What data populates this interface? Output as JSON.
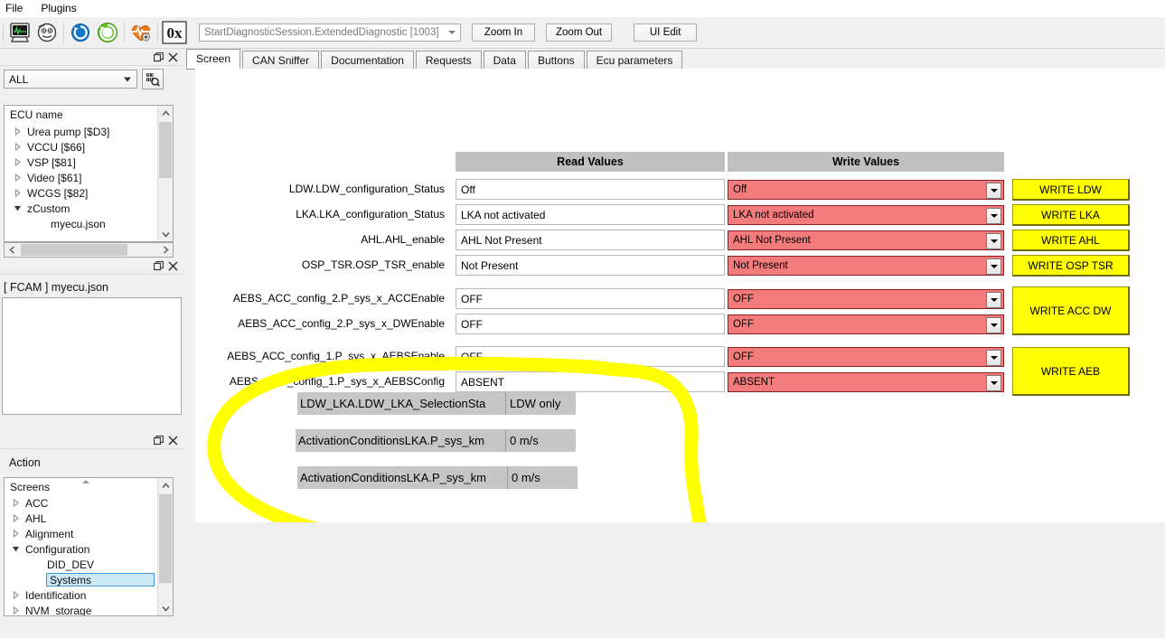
{
  "menu": {
    "items": [
      "File",
      "Plugins"
    ]
  },
  "toolbar": {
    "icons": [
      "scope-monitor-icon",
      "ecu-face-icon",
      "refresh-blue-icon",
      "refresh-green-icon",
      "heartbeat-icon",
      "hex-0x-icon"
    ],
    "session_combo_value": "StartDiagnosticSession.ExtendedDiagnostic [1003]",
    "zoom_in_label": "Zoom In",
    "zoom_out_label": "Zoom Out",
    "ui_edit_label": "UI Edit"
  },
  "ecu_panel": {
    "filter_value": "ALL",
    "search_icon": "barcode-search-icon",
    "tree_header": "ECU name",
    "items": [
      {
        "label": "Urea pump [$D3]",
        "expanded": false,
        "indent": 0,
        "has_toggle": true
      },
      {
        "label": "VCCU [$66]",
        "expanded": false,
        "indent": 0,
        "has_toggle": true
      },
      {
        "label": "VSP [$81]",
        "expanded": false,
        "indent": 0,
        "has_toggle": true
      },
      {
        "label": "Video [$61]",
        "expanded": false,
        "indent": 0,
        "has_toggle": true
      },
      {
        "label": "WCGS [$82]",
        "expanded": false,
        "indent": 0,
        "has_toggle": true
      },
      {
        "label": "zCustom",
        "expanded": true,
        "indent": 0,
        "has_toggle": true
      },
      {
        "label": "myecu.json",
        "expanded": false,
        "indent": 1,
        "has_toggle": false
      }
    ]
  },
  "fcam_panel": {
    "title": "[ FCAM ] myecu.json"
  },
  "action_panel": {
    "label": "Action",
    "tree_header": "Screens",
    "items": [
      {
        "label": "ACC",
        "expanded": false,
        "indent": 0,
        "has_toggle": true,
        "selected": false
      },
      {
        "label": "AHL",
        "expanded": false,
        "indent": 0,
        "has_toggle": true,
        "selected": false
      },
      {
        "label": "Alignment",
        "expanded": false,
        "indent": 0,
        "has_toggle": true,
        "selected": false
      },
      {
        "label": "Configuration",
        "expanded": true,
        "indent": 0,
        "has_toggle": true,
        "selected": false
      },
      {
        "label": "DID_DEV",
        "expanded": false,
        "indent": 1,
        "has_toggle": false,
        "selected": false
      },
      {
        "label": "Systems",
        "expanded": false,
        "indent": 1,
        "has_toggle": false,
        "selected": true
      },
      {
        "label": "Identification",
        "expanded": false,
        "indent": 0,
        "has_toggle": true,
        "selected": false
      },
      {
        "label": "NVM_storage",
        "expanded": false,
        "indent": 0,
        "has_toggle": true,
        "selected": false
      }
    ]
  },
  "tabs": [
    {
      "label": "Screen",
      "active": true
    },
    {
      "label": "CAN Sniffer",
      "active": false
    },
    {
      "label": "Documentation",
      "active": false
    },
    {
      "label": "Requests",
      "active": false
    },
    {
      "label": "Data",
      "active": false
    },
    {
      "label": "Buttons",
      "active": false
    },
    {
      "label": "Ecu parameters",
      "active": false
    }
  ],
  "screen": {
    "col_headers": {
      "read": "Read Values",
      "write": "Write Values"
    },
    "rows": [
      {
        "label": "LDW.LDW_configuration_Status",
        "read": "Off",
        "write": "Off"
      },
      {
        "label": "LKA.LKA_configuration_Status",
        "read": "LKA not activated",
        "write": "LKA not activated"
      },
      {
        "label": "AHL.AHL_enable",
        "read": "AHL Not Present",
        "write": "AHL Not Present"
      },
      {
        "label": "OSP_TSR.OSP_TSR_enable",
        "read": "Not Present",
        "write": "Not Present"
      },
      {
        "label": "AEBS_ACC_config_2.P_sys_x_ACCEnable",
        "read": "OFF",
        "write": "OFF"
      },
      {
        "label": "AEBS_ACC_config_2.P_sys_x_DWEnable",
        "read": "OFF",
        "write": "OFF"
      },
      {
        "label": "AEBS_ACC_config_1.P_sys_x_AEBSEnable",
        "read": "OFF",
        "write": "OFF"
      },
      {
        "label": "AEBS_ACC_config_1.P_sys_x_AEBSConfig",
        "read": "ABSENT",
        "write": "ABSENT"
      }
    ],
    "write_buttons": [
      {
        "label": "WRITE LDW"
      },
      {
        "label": "WRITE LKA"
      },
      {
        "label": "WRITE AHL"
      },
      {
        "label": "WRITE OSP TSR"
      },
      {
        "label": "WRITE ACC DW"
      },
      {
        "label": "WRITE AEB"
      }
    ],
    "params": [
      {
        "label": "LDW_LKA.LDW_LKA_SelectionSta",
        "value": "LDW only"
      },
      {
        "label": "ActivationConditionsLKA.P_sys_km",
        "value": "0 m/s"
      },
      {
        "label": "ActivationConditionsLKA.P_sys_km",
        "value": "0 m/s"
      }
    ],
    "annotation": {
      "shape": "hand-drawn-ellipse",
      "color": "#ffff00"
    }
  },
  "colors": {
    "write_cell_bg": "#f47b7b",
    "write_cell_border": "#8c2020",
    "write_button_bg": "#ffff00",
    "header_bg": "#c0c0c0",
    "param_box_bg": "#c6c6c6",
    "selection_bg": "#cde8f7",
    "annotation": "#ffff00"
  }
}
